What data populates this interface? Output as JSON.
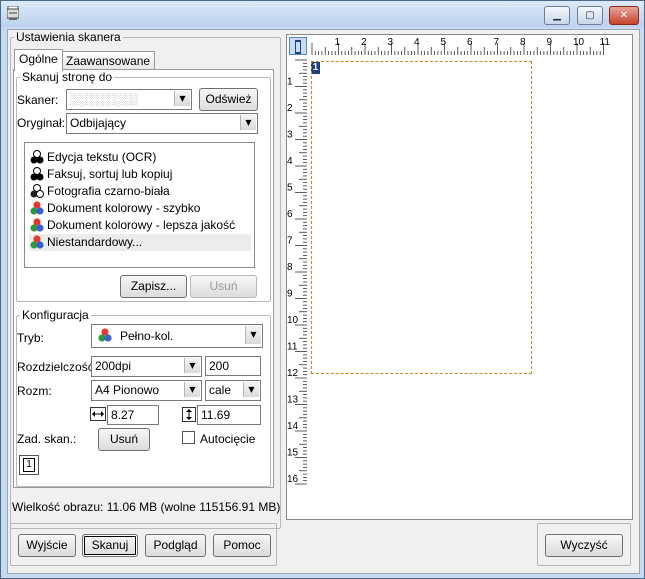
{
  "window": {
    "title": "",
    "controls": {
      "minimize": "▁",
      "maximize": "▢",
      "close": "✕"
    }
  },
  "settings": {
    "group_title": "Ustawienia skanera",
    "tabs": [
      {
        "label": "Ogólne"
      },
      {
        "label": "Zaawansowane"
      }
    ],
    "scan_to": {
      "title": "Skanuj stronę do",
      "scanner_label": "Skaner:",
      "scanner_value": "░░░░░░░░",
      "refresh_button": "Odśwież",
      "original_label": "Oryginał:",
      "original_value": "Odbijający",
      "profiles": [
        {
          "label": "Edycja tekstu (OCR)",
          "icon": "bw-circles-icon"
        },
        {
          "label": "Faksuj, sortuj lub kopiuj",
          "icon": "bw-circles-icon"
        },
        {
          "label": "Fotografia czarno-biała",
          "icon": "grayscale-circles-icon"
        },
        {
          "label": "Dokument kolorowy - szybko",
          "icon": "color-circles-icon"
        },
        {
          "label": "Dokument kolorowy - lepsza jakość",
          "icon": "color-circles-icon"
        },
        {
          "label": "Niestandardowy...",
          "icon": "color-circles-icon"
        }
      ],
      "selected_profile": "Niestandardowy...",
      "save_button": "Zapisz...",
      "delete_button": "Usuń"
    },
    "config": {
      "title": "Konfiguracja",
      "mode_label": "Tryb:",
      "mode_value": "Pełno-kol.",
      "resolution_label": "Rozdzielczość:",
      "resolution_value": "200dpi",
      "resolution_custom": "200",
      "size_label": "Rozm:",
      "size_value": "A4 Pionowo",
      "unit_value": "cale",
      "width_value": "8.27",
      "height_value": "11.69",
      "areas_label": "Zad. skan.:",
      "areas_delete_button": "Usuń",
      "autocrop_label": "Autocięcie",
      "autocrop_checked": false,
      "area_number": "1"
    },
    "status": "Wielkość obrazu: 11.06 MB (wolne 115156.91 MB)"
  },
  "preview": {
    "h_ruler": [
      "1",
      "2",
      "3",
      "4",
      "5",
      "6",
      "7",
      "8",
      "9",
      "10",
      "11"
    ],
    "v_ruler": [
      "1",
      "2",
      "3",
      "4",
      "5",
      "6",
      "7",
      "8",
      "9",
      "10",
      "11",
      "12",
      "13",
      "14",
      "15",
      "16"
    ],
    "area_label": "1"
  },
  "bottom": {
    "exit_button": "Wyjście",
    "scan_button": "Skanuj",
    "preview_button": "Podgląd",
    "help_button": "Pomoc",
    "clear_button": "Wyczyść"
  }
}
